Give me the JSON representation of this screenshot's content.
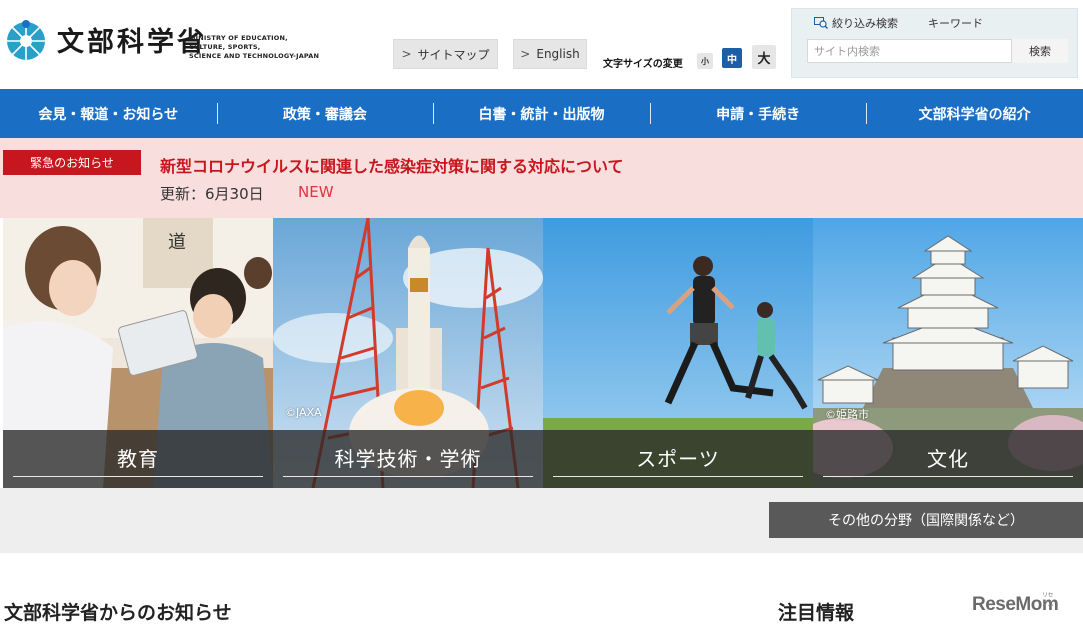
{
  "header": {
    "logo_jp": "文部科学省",
    "logo_en_lines": [
      "MINISTRY OF EDUCATION,",
      "CULTURE, SPORTS,",
      "SCIENCE AND TECHNOLOGY-JAPAN"
    ],
    "sitemap_label": "サイトマップ",
    "english_label": "English",
    "font_size_label": "文字サイズの変更",
    "font_sizes": [
      "小",
      "中",
      "大"
    ],
    "filter_search_label": "絞り込み検索",
    "keyword_label": "キーワード",
    "search_placeholder": "サイト内検索",
    "search_button": "検索"
  },
  "nav": {
    "items": [
      "会見・報道・お知らせ",
      "政策・審議会",
      "白書・統計・出版物",
      "申請・手続き",
      "文部科学省の紹介"
    ]
  },
  "emergency": {
    "badge": "緊急のお知らせ",
    "title": "新型コロナウイルスに関連した感染症対策に関する対応について",
    "update": "更新：6月30日",
    "new_label": "NEW"
  },
  "tiles": [
    {
      "label": "教育",
      "credit": ""
    },
    {
      "label": "科学技術・学術",
      "credit": "©JAXA"
    },
    {
      "label": "スポーツ",
      "credit": ""
    },
    {
      "label": "文化",
      "credit": "©姫路市"
    }
  ],
  "other_fields_label": "その他の分野（国際関係など）",
  "sections": {
    "news_title": "文部科学省からのお知らせ",
    "featured_title": "注目情報"
  },
  "watermark": {
    "text": "ReseMom",
    "ruby": "リセマム"
  },
  "colors": {
    "nav_blue": "#1a6fc4",
    "emergency_red": "#c8161e",
    "emergency_bg": "#f9dede"
  }
}
